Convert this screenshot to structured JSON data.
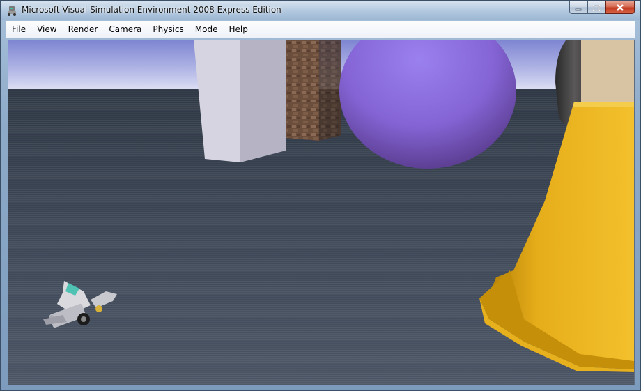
{
  "window": {
    "title": "Microsoft Visual Simulation Environment 2008 Express Edition",
    "icon": "robot-app-icon"
  },
  "caption_buttons": {
    "minimize_icon": "minimize-icon",
    "maximize_icon": "maximize-icon",
    "close_icon": "close-icon"
  },
  "menu": {
    "items": [
      "File",
      "View",
      "Render",
      "Camera",
      "Physics",
      "Mode",
      "Help"
    ]
  },
  "scene": {
    "objects": [
      "white-box",
      "brick-pillar",
      "purple-sphere",
      "dark-cylinder",
      "beige-cylinder",
      "yellow-cone",
      "lego-robot"
    ],
    "colors": {
      "sky": "#8a8fd6",
      "ground": "#3e4856",
      "sphere": "#8b6ad8",
      "cone": "#e0a417",
      "box": "#cbc9d7"
    }
  }
}
